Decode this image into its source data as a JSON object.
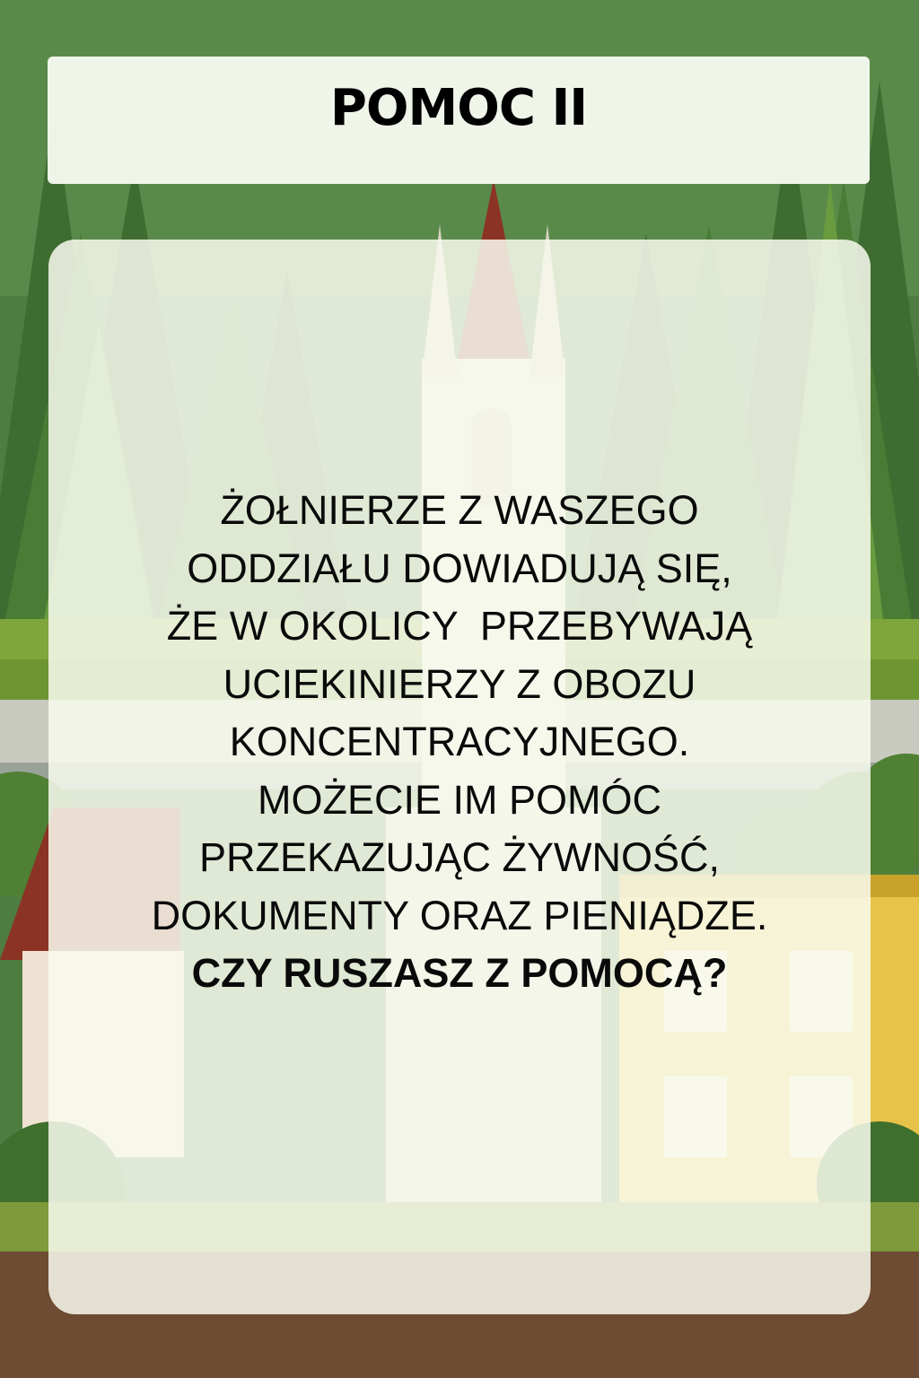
{
  "title": "POMOC II",
  "body_lines": [
    "ŻOŁNIERZE Z WASZEGO",
    "ODDZIAŁU DOWIADUJĄ SIĘ,",
    "ŻE W OKOLICY  PRZEBYWAJĄ",
    "UCIEKINIERZY Z OBOZU",
    "KONCENTRACYJNEGO.",
    "MOŻECIE IM POMÓC",
    "PRZEKAZUJĄC ŻYWNOŚĆ,",
    "DOKUMENTY ORAZ PIENIĄDZE."
  ],
  "question": "CZY RUSZASZ Z POMOCĄ?",
  "colors": {
    "sky": "#4f7d41",
    "forest_dark": "#3c6a2f",
    "forest_mid": "#5b8c3a",
    "grass": "#7ea63c",
    "road": "#c8c9bf",
    "ground": "#6e4b33",
    "yellow_house": "#e8c34a",
    "roof_red": "#8b3324",
    "card_bg": "#f7faef",
    "text": "#000000"
  }
}
